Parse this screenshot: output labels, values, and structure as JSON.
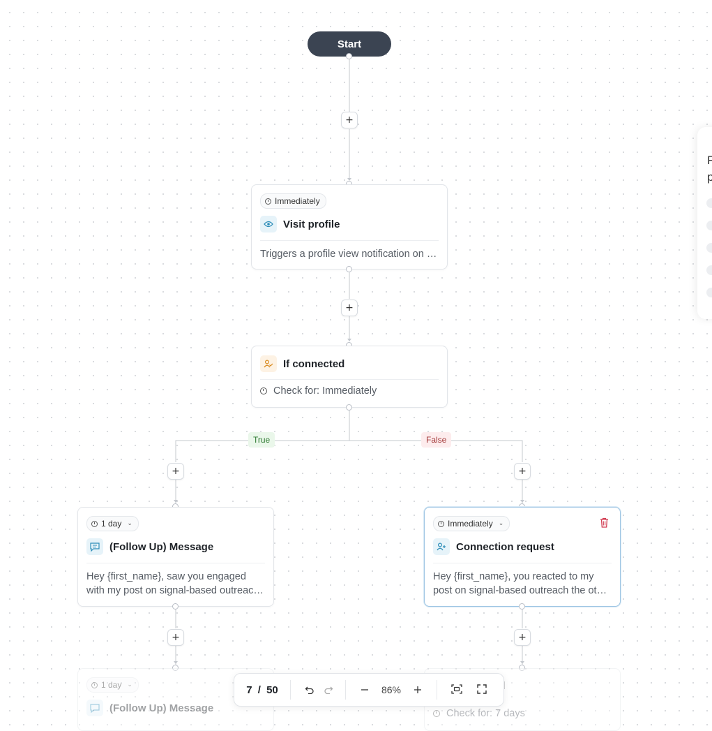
{
  "flow": {
    "start_label": "Start",
    "add_step_symbol": "+",
    "branch_true_label": "True",
    "branch_false_label": "False"
  },
  "nodes": {
    "visit_profile": {
      "delay": "Immediately",
      "icon": "eye-icon",
      "title": "Visit profile",
      "description": "Triggers a profile view notification on their side"
    },
    "if_connected": {
      "icon": "user-check-icon",
      "title": "If connected",
      "check_text": "Check for: Immediately"
    },
    "follow_up_message": {
      "delay": "1 day",
      "icon": "message-icon",
      "title": "(Follow Up) Message",
      "description": "Hey {first_name}, saw you engaged with my post on signal-based outreach, curious what caught your eye"
    },
    "connection_request": {
      "delay": "Immediately",
      "icon": "user-plus-icon",
      "title": "Connection request",
      "description": "Hey {first_name}, you reacted to my post on signal-based outreach the other day"
    },
    "follow_up_message_2": {
      "delay": "1 day",
      "title": "(Follow Up) Message"
    },
    "if_connected_2": {
      "title_partial": "ed",
      "check_text": "Check for: 7 days"
    }
  },
  "side_panel": {
    "lines": [
      "F",
      "p"
    ]
  },
  "toolbar": {
    "page_current": "7",
    "page_separator": "/",
    "page_total": "50",
    "zoom_level": "86%"
  },
  "colors": {
    "start_node": "#3b4452",
    "selected_border": "#9ec5e3",
    "true_badge": "#eaf7ea",
    "false_badge": "#fdeced",
    "delete": "#d23b50"
  }
}
